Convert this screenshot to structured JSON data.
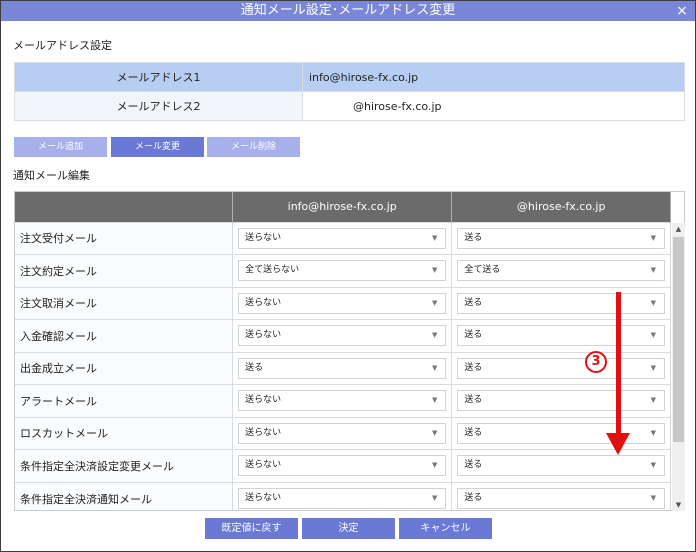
{
  "window": {
    "title": "通知メール設定･メールアドレス変更",
    "close_label": "×"
  },
  "address_settings": {
    "section_title": "メールアドレス設定",
    "rows": [
      {
        "label": "メールアドレス1",
        "value": "info@hirose-fx.co.jp"
      },
      {
        "label": "メールアドレス2",
        "value": "@hirose-fx.co.jp"
      }
    ]
  },
  "address_buttons": {
    "add": "メール追加",
    "change": "メール変更",
    "delete": "メール削除"
  },
  "notification": {
    "section_title": "通知メール編集",
    "columns": [
      "info@hirose-fx.co.jp",
      "@hirose-fx.co.jp"
    ],
    "rows": [
      {
        "label": "注文受付メール",
        "col1": "送らない",
        "col2": "送る"
      },
      {
        "label": "注文約定メール",
        "col1": "全て送らない",
        "col2": "全て送る"
      },
      {
        "label": "注文取消メール",
        "col1": "送らない",
        "col2": "送る"
      },
      {
        "label": "入金確認メール",
        "col1": "送らない",
        "col2": "送る"
      },
      {
        "label": "出金成立メール",
        "col1": "送る",
        "col2": "送る"
      },
      {
        "label": "アラートメール",
        "col1": "送らない",
        "col2": "送る"
      },
      {
        "label": "ロスカットメール",
        "col1": "送らない",
        "col2": "送る"
      },
      {
        "label": "条件指定全決済設定変更メール",
        "col1": "送らない",
        "col2": "送る"
      },
      {
        "label": "条件指定全決済通知メール",
        "col1": "送らない",
        "col2": "送る"
      }
    ]
  },
  "footer": {
    "reset": "既定値に戻す",
    "ok": "決定",
    "cancel": "キャンセル"
  },
  "annotation": {
    "number": "3"
  },
  "icons": {
    "dropdown": "▼",
    "scroll_up": "▲",
    "scroll_down": "▼"
  },
  "colors": {
    "titlebar": "#7a87d6",
    "button": "#6a78d6",
    "button_disabled": "#a7b0ea",
    "header": "#6b6b6b",
    "annotation": "#e01010"
  }
}
